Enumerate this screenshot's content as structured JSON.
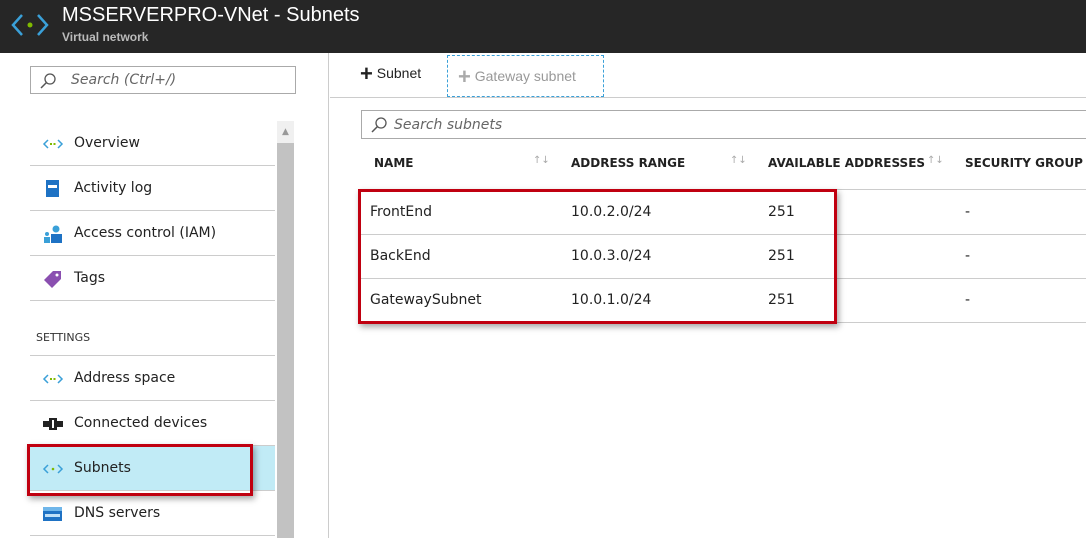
{
  "header": {
    "title": "MSSERVERPRO-VNet - Subnets",
    "subtitle": "Virtual network"
  },
  "sidebar": {
    "search_placeholder": "Search (Ctrl+/)",
    "items": [
      {
        "label": "Overview"
      },
      {
        "label": "Activity log"
      },
      {
        "label": "Access control (IAM)"
      },
      {
        "label": "Tags"
      }
    ],
    "section": "SETTINGS",
    "settings_items": [
      {
        "label": "Address space"
      },
      {
        "label": "Connected devices"
      },
      {
        "label": "Subnets",
        "selected": true
      },
      {
        "label": "DNS servers"
      }
    ]
  },
  "toolbar": {
    "add_subnet": "Subnet",
    "gateway_subnet": "Gateway subnet"
  },
  "search": {
    "placeholder": "Search subnets"
  },
  "table": {
    "headers": [
      "NAME",
      "ADDRESS RANGE",
      "AVAILABLE ADDRESSES",
      "SECURITY GROUP"
    ],
    "rows": [
      {
        "name": "FrontEnd",
        "range": "10.0.2.0/24",
        "available": "251",
        "nsg": "-"
      },
      {
        "name": "BackEnd",
        "range": "10.0.3.0/24",
        "available": "251",
        "nsg": "-"
      },
      {
        "name": "GatewaySubnet",
        "range": "10.0.1.0/24",
        "available": "251",
        "nsg": "-"
      }
    ]
  },
  "colors": {
    "highlight": "#c1ebf6",
    "annotation": "#c00010",
    "header_bg": "#262626"
  }
}
